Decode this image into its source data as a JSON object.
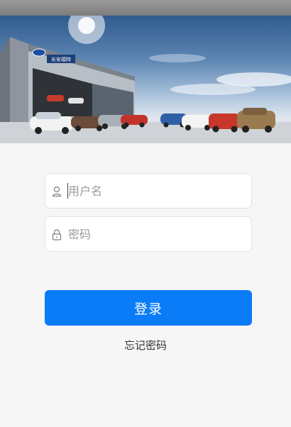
{
  "banner": {
    "image": "ford-dealership-showroom-photo",
    "sign_text": "长安福特"
  },
  "login_form": {
    "username": {
      "icon": "user-icon",
      "value": "",
      "placeholder": "用户名"
    },
    "password": {
      "icon": "lock-icon",
      "value": "",
      "placeholder": "密码"
    },
    "submit_label": "登录",
    "forgot_password_label": "忘记密码"
  },
  "colors": {
    "background": "#f6f6f6",
    "primary_button": "#0a7cf7",
    "field_border": "#e2e2e2",
    "placeholder": "#9b9b9b"
  }
}
